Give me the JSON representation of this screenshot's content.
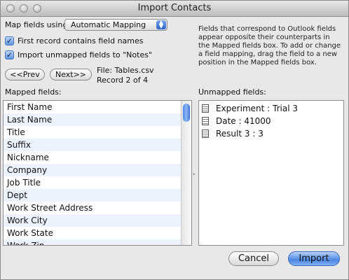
{
  "window": {
    "title": "Import Contacts"
  },
  "map_fields": {
    "label": "Map fields using:",
    "selected": "Automatic Mapping"
  },
  "checkboxes": [
    {
      "label": "First record contains field names",
      "checked": true
    },
    {
      "label": "Import unmapped fields to \"Notes\"",
      "checked": true
    }
  ],
  "nav": {
    "prev_label": "<<Prev",
    "next_label": "Next>>",
    "file": "File: Tables.csv",
    "record": "Record 2 of 4"
  },
  "description": "Fields that correspond to Outlook fields appear opposite their counterparts in the Mapped fields box. To add or change a field mapping, drag the field to a new position in the Mapped fields box.",
  "mapped": {
    "label": "Mapped fields:",
    "items": [
      "First Name",
      "Last Name",
      "Title",
      "Suffix",
      "Nickname",
      "Company",
      "Job Title",
      "Dept",
      "Work Street Address",
      "Work City",
      "Work State",
      "Work Zip"
    ]
  },
  "unmapped": {
    "label": "Unmapped fields:",
    "items": [
      "Experiment : Trial 3",
      "Date : 41000",
      "Result 3 : 3"
    ]
  },
  "divider_arrow": "‸",
  "buttons": {
    "cancel_label": "Cancel",
    "import_label": "Import"
  }
}
